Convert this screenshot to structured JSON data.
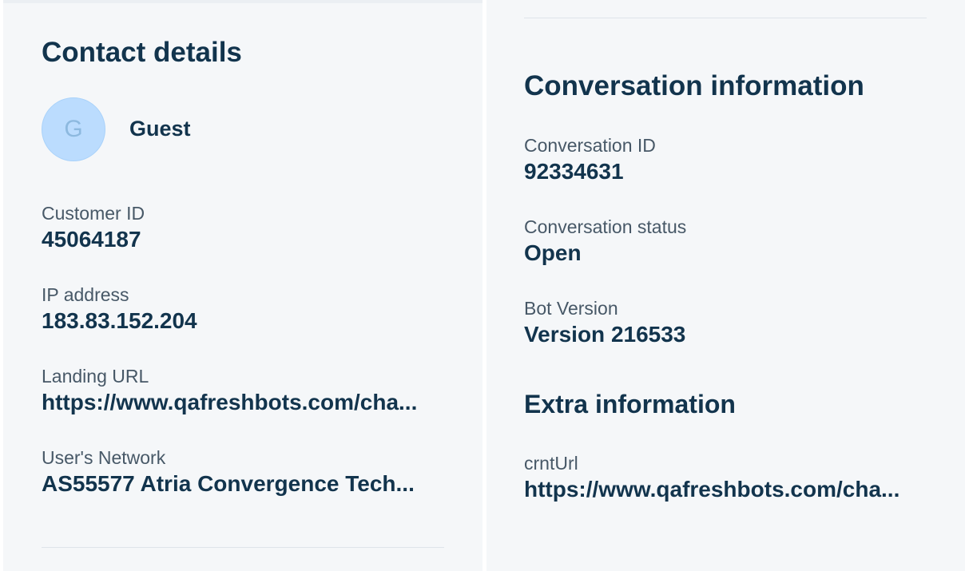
{
  "contact": {
    "title": "Contact details",
    "avatar_initial": "G",
    "name": "Guest",
    "fields": [
      {
        "label": "Customer ID",
        "value": "45064187"
      },
      {
        "label": "IP address",
        "value": "183.83.152.204"
      },
      {
        "label": "Landing URL",
        "value": "https://www.qafreshbots.com/cha..."
      },
      {
        "label": "User's Network",
        "value": "AS55577 Atria Convergence Tech..."
      }
    ]
  },
  "conversation": {
    "title": "Conversation information",
    "fields": [
      {
        "label": "Conversation ID",
        "value": "92334631"
      },
      {
        "label": "Conversation status",
        "value": "Open"
      },
      {
        "label": "Bot Version",
        "value": "Version 216533"
      }
    ]
  },
  "extra": {
    "title": "Extra information",
    "fields": [
      {
        "label": "crntUrl",
        "value": "https://www.qafreshbots.com/cha..."
      }
    ]
  },
  "colors": {
    "panel_bg": "#f5f7f9",
    "heading": "#12344d",
    "label": "#475867",
    "avatar_bg": "#bbdcfe"
  }
}
